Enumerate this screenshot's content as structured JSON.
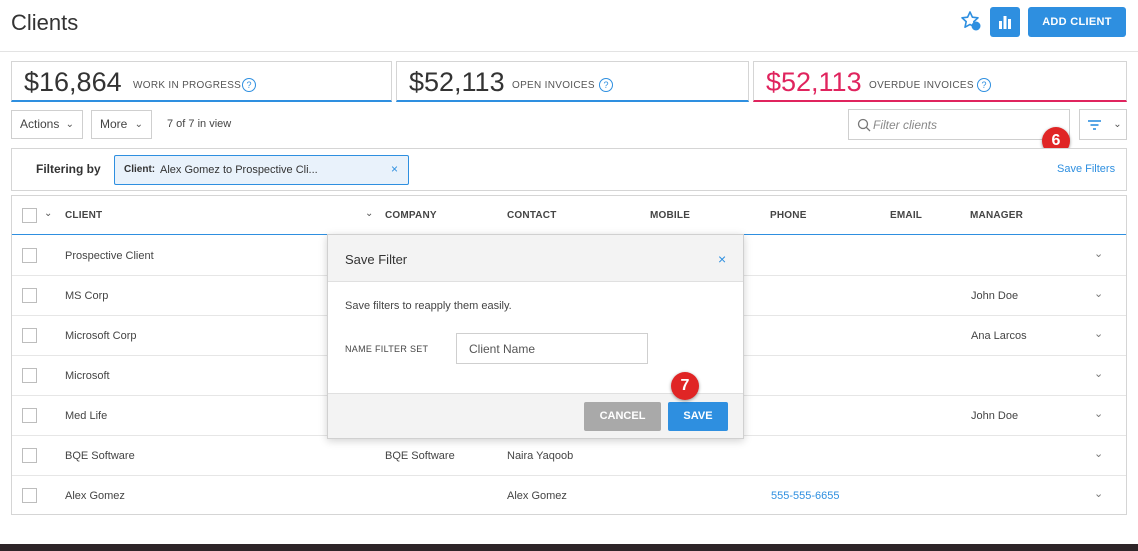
{
  "header": {
    "title": "Clients",
    "add_client_label": "ADD CLIENT"
  },
  "kpis": [
    {
      "amount": "$16,864",
      "label": "WORK IN PROGRESS",
      "help": "?"
    },
    {
      "amount": "$52,113",
      "label": "OPEN INVOICES",
      "help": "?"
    },
    {
      "amount": "$52,113",
      "label": "OVERDUE INVOICES",
      "help": "?"
    }
  ],
  "toolbar": {
    "actions_label": "Actions",
    "more_label": "More",
    "in_view": "7 of 7 in view",
    "filter_placeholder": "Filter clients"
  },
  "filters": {
    "label": "Filtering by",
    "chip_key": "Client:",
    "chip_value": "Alex Gomez to Prospective Cli...",
    "chip_close": "×",
    "save_filters_label": "Save Filters"
  },
  "steps": {
    "six": "6",
    "seven": "7"
  },
  "table": {
    "columns": [
      "CLIENT",
      "COMPANY",
      "CONTACT",
      "MOBILE",
      "PHONE",
      "EMAIL",
      "MANAGER"
    ],
    "rows": [
      {
        "client": "Prospective Client",
        "company": "",
        "contact": "",
        "phone": "",
        "manager": ""
      },
      {
        "client": "MS Corp",
        "company": "",
        "contact": "",
        "phone": "",
        "manager": "John Doe"
      },
      {
        "client": "Microsoft Corp",
        "company": "",
        "contact": "",
        "phone": "",
        "manager": "Ana Larcos"
      },
      {
        "client": "Microsoft",
        "company": "",
        "contact": "",
        "phone": "",
        "manager": ""
      },
      {
        "client": "Med Life",
        "company": "",
        "contact": "",
        "phone": "",
        "manager": "John Doe"
      },
      {
        "client": "BQE Software",
        "company": "BQE Software",
        "contact": "Naira Yaqoob",
        "phone": "",
        "manager": ""
      },
      {
        "client": "Alex Gomez",
        "company": "",
        "contact": "Alex Gomez",
        "phone": "555-555-6655",
        "manager": ""
      }
    ]
  },
  "dialog": {
    "title": "Save Filter",
    "close": "×",
    "description": "Save filters to reapply them easily.",
    "field_label": "NAME FILTER SET",
    "field_placeholder": "Client Name",
    "cancel_label": "CANCEL",
    "save_label": "SAVE"
  },
  "colors": {
    "accent": "#2e8fe0",
    "overdue": "#e0245e",
    "step_badge": "#e02525"
  }
}
